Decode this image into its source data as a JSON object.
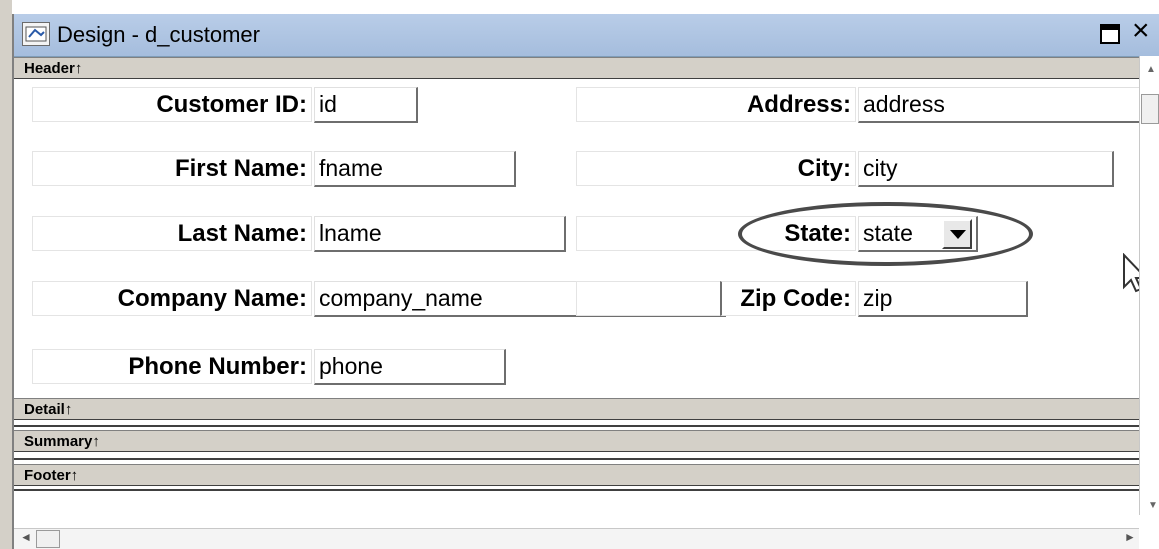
{
  "window": {
    "title": "Design - d_customer",
    "icon": "datawindow-icon",
    "maximize_icon": "maximize-icon",
    "close_label": "×"
  },
  "bands": {
    "header": "Header↑",
    "detail": "Detail↑",
    "summary": "Summary↑",
    "footer": "Footer↑"
  },
  "fields": {
    "customer_id": {
      "label": "Customer ID:",
      "value": "id"
    },
    "first_name": {
      "label": "First Name:",
      "value": "fname"
    },
    "last_name": {
      "label": "Last Name:",
      "value": "lname"
    },
    "company_name": {
      "label": "Company Name:",
      "value": "company_name"
    },
    "phone_number": {
      "label": "Phone Number:",
      "value": "phone"
    },
    "address": {
      "label": "Address:",
      "value": "address"
    },
    "city": {
      "label": "City:",
      "value": "city"
    },
    "state": {
      "label": "State:",
      "value": "state"
    },
    "zip_code": {
      "label": "Zip Code:",
      "value": "zip"
    }
  },
  "scrollbar": {
    "up": "▲",
    "down": "▼",
    "left": "◄",
    "right": "►"
  },
  "colors": {
    "title_bar": "#b9cde8",
    "band": "#d4d0c8",
    "highlight": "#4a4a4a"
  }
}
